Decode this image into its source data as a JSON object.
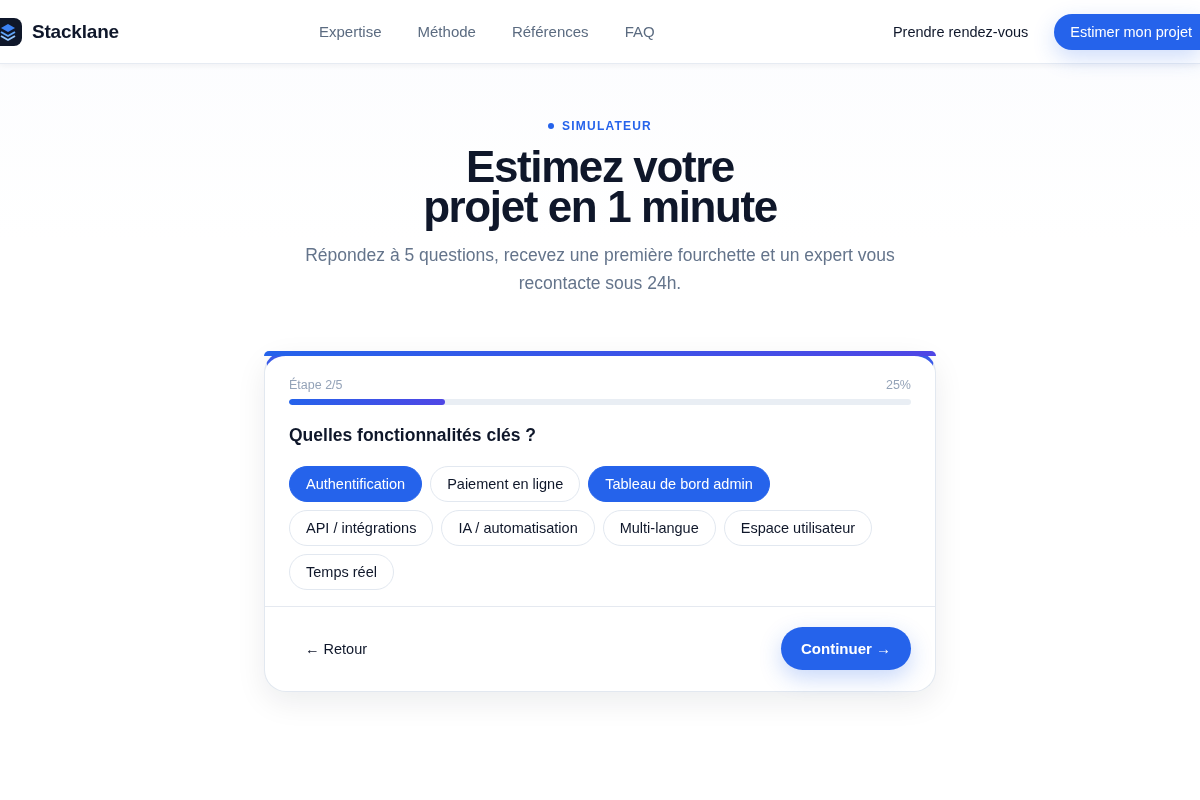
{
  "header": {
    "brand": "Stacklane",
    "nav": [
      "Expertise",
      "Méthode",
      "Références",
      "FAQ"
    ],
    "secondary_link": "Prendre rendez-vous",
    "cta": "Estimer mon projet"
  },
  "hero": {
    "eyebrow": "SIMULATEUR",
    "title": "Estimez votre projet en 1 minute",
    "subtitle": "Répondez à 5 questions, recevez une première fourchette et un expert vous recontacte sous 24h."
  },
  "simulator": {
    "step": "Étape 2/5",
    "percent": "25%",
    "progress": {
      "level": 0.25
    },
    "question": "Quelles fonctionnalités clés ?",
    "options": [
      {
        "label": "Authentification",
        "selected": true
      },
      {
        "label": "Paiement en ligne",
        "selected": false
      },
      {
        "label": "Tableau de bord admin",
        "selected": true
      },
      {
        "label": "API / intégrations",
        "selected": false
      },
      {
        "label": "IA / automatisation",
        "selected": false
      },
      {
        "label": "Multi-langue",
        "selected": false
      },
      {
        "label": "Espace utilisateur",
        "selected": false
      },
      {
        "label": "Temps réel",
        "selected": false
      }
    ],
    "back": "← Retour",
    "next": "Continuer →"
  }
}
